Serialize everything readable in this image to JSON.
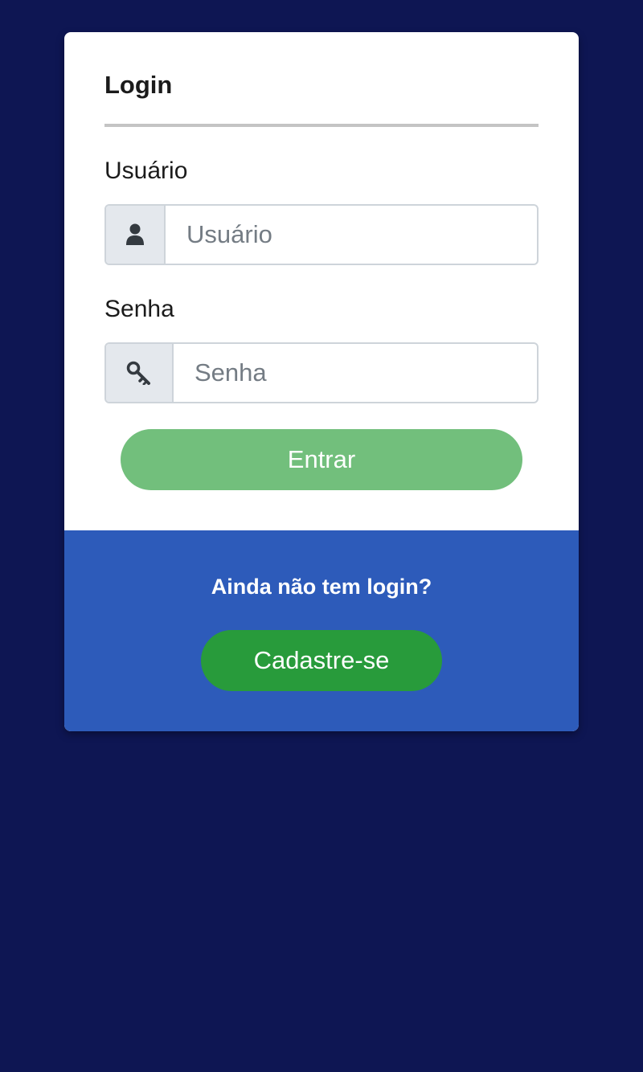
{
  "login_card": {
    "title": "Login",
    "username": {
      "label": "Usuário",
      "placeholder": "Usuário",
      "value": "",
      "icon": "user-icon"
    },
    "password": {
      "label": "Senha",
      "placeholder": "Senha",
      "value": "",
      "icon": "key-icon"
    },
    "submit_label": "Entrar"
  },
  "footer": {
    "prompt": "Ainda não tem login?",
    "register_label": "Cadastre-se"
  },
  "colors": {
    "page_background": "#0e1653",
    "footer_background": "#2d5bba",
    "submit_button": "#72bf7c",
    "register_button": "#289b3b"
  }
}
